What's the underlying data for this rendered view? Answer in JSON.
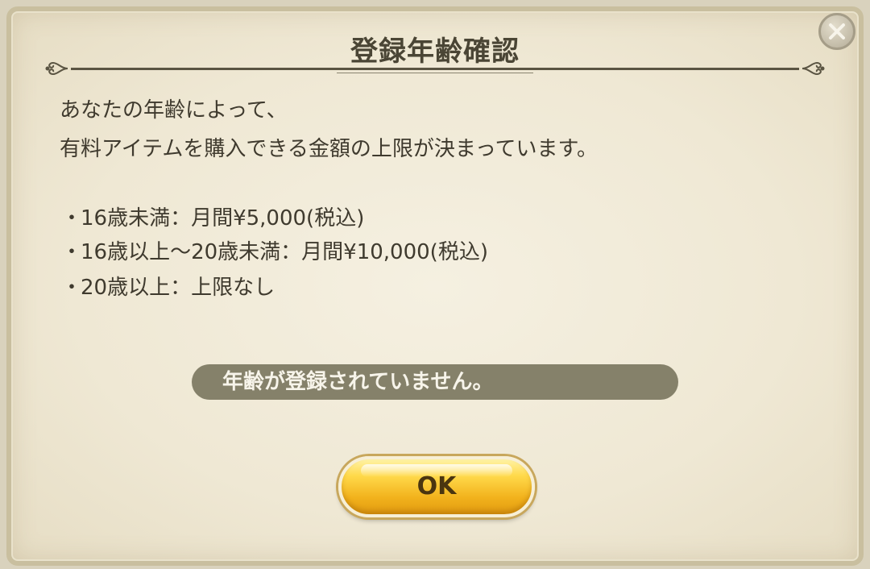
{
  "dialog": {
    "title": "登録年齢確認",
    "intro_line1": "あなたの年齢によって、",
    "intro_line2": "有料アイテムを購入できる金額の上限が決まっています。",
    "bullet_mark": "・",
    "limits": [
      "16歳未満：月間¥5,000(税込)",
      "16歳以上～20歳未満：月間¥10,000(税込)",
      "20歳以上：上限なし"
    ],
    "notice": "年齢が登録されていません。",
    "ok_label": "OK",
    "close_icon": "close-x-icon"
  },
  "colors": {
    "panel_bg": "#efe8d4",
    "text": "#3f3a2e",
    "notice_bg": "#85816a",
    "ok_gold": "#ffd94a"
  }
}
